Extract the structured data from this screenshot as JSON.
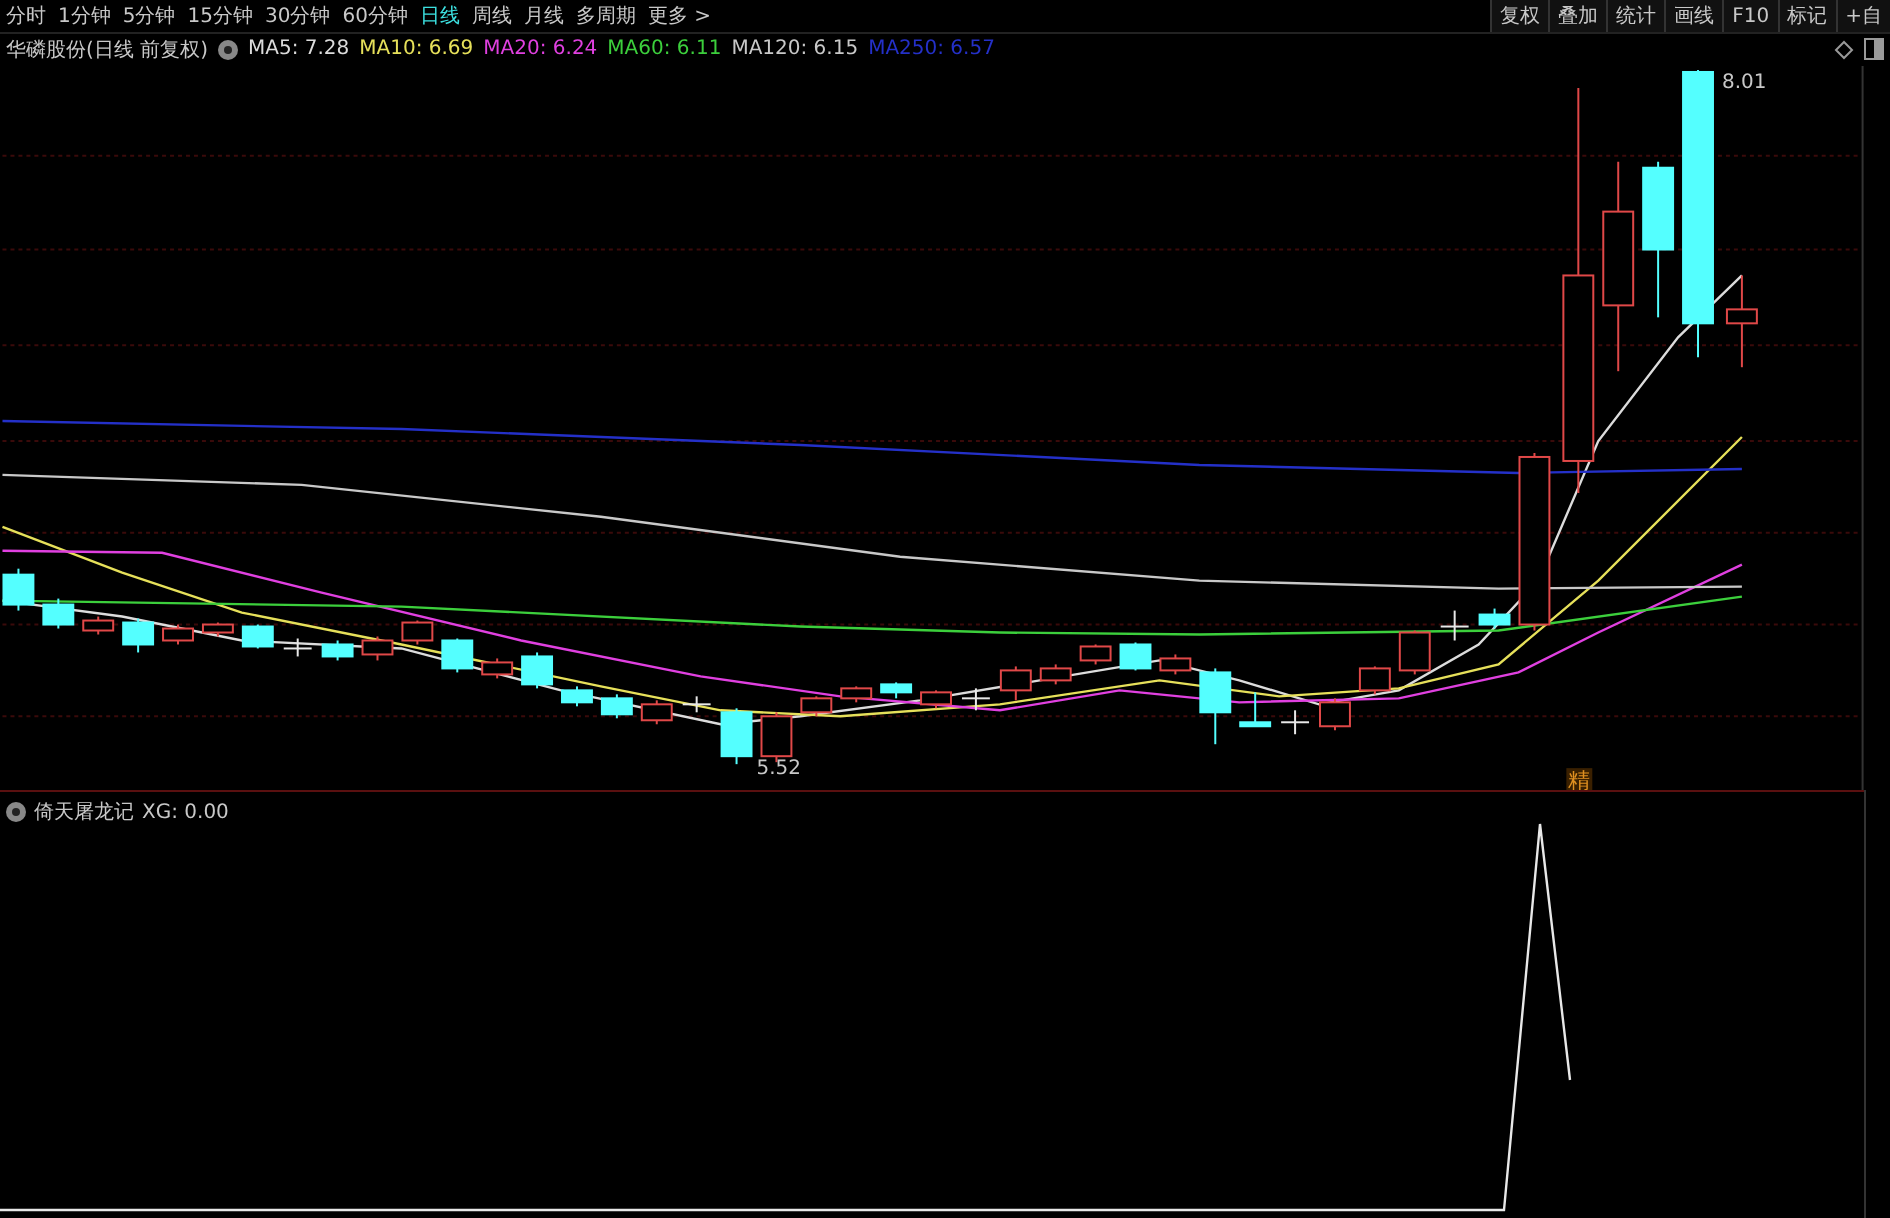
{
  "toolbar": {
    "tabs": [
      {
        "label": "分时",
        "selected": false
      },
      {
        "label": "1分钟",
        "selected": false
      },
      {
        "label": "5分钟",
        "selected": false
      },
      {
        "label": "15分钟",
        "selected": false
      },
      {
        "label": "30分钟",
        "selected": false
      },
      {
        "label": "60分钟",
        "selected": false
      },
      {
        "label": "日线",
        "selected": true
      },
      {
        "label": "周线",
        "selected": false
      },
      {
        "label": "月线",
        "selected": false
      },
      {
        "label": "多周期",
        "selected": false
      },
      {
        "label": "更多 >",
        "selected": false
      }
    ],
    "buttons": [
      "复权",
      "叠加",
      "统计",
      "画线",
      "F10",
      "标记",
      "+自"
    ]
  },
  "legend": {
    "title": "华磷股份(日线 前复权)",
    "items": [
      {
        "label": "MA5: 7.28",
        "color": "#dcdcdc"
      },
      {
        "label": "MA10: 6.69",
        "color": "#e6e05a"
      },
      {
        "label": "MA20: 6.24",
        "color": "#e040e0"
      },
      {
        "label": "MA60: 6.11",
        "color": "#3ccf3c"
      },
      {
        "label": "MA120: 6.15",
        "color": "#c8c8c8"
      },
      {
        "label": "MA250: 6.57",
        "color": "#2430c8"
      }
    ]
  },
  "price_chart": {
    "high_label": "8.01",
    "low_label": "5.52",
    "signal_marker": "精"
  },
  "indicator": {
    "title": "倚天屠龙记",
    "reading": "XG: 0.00"
  }
}
